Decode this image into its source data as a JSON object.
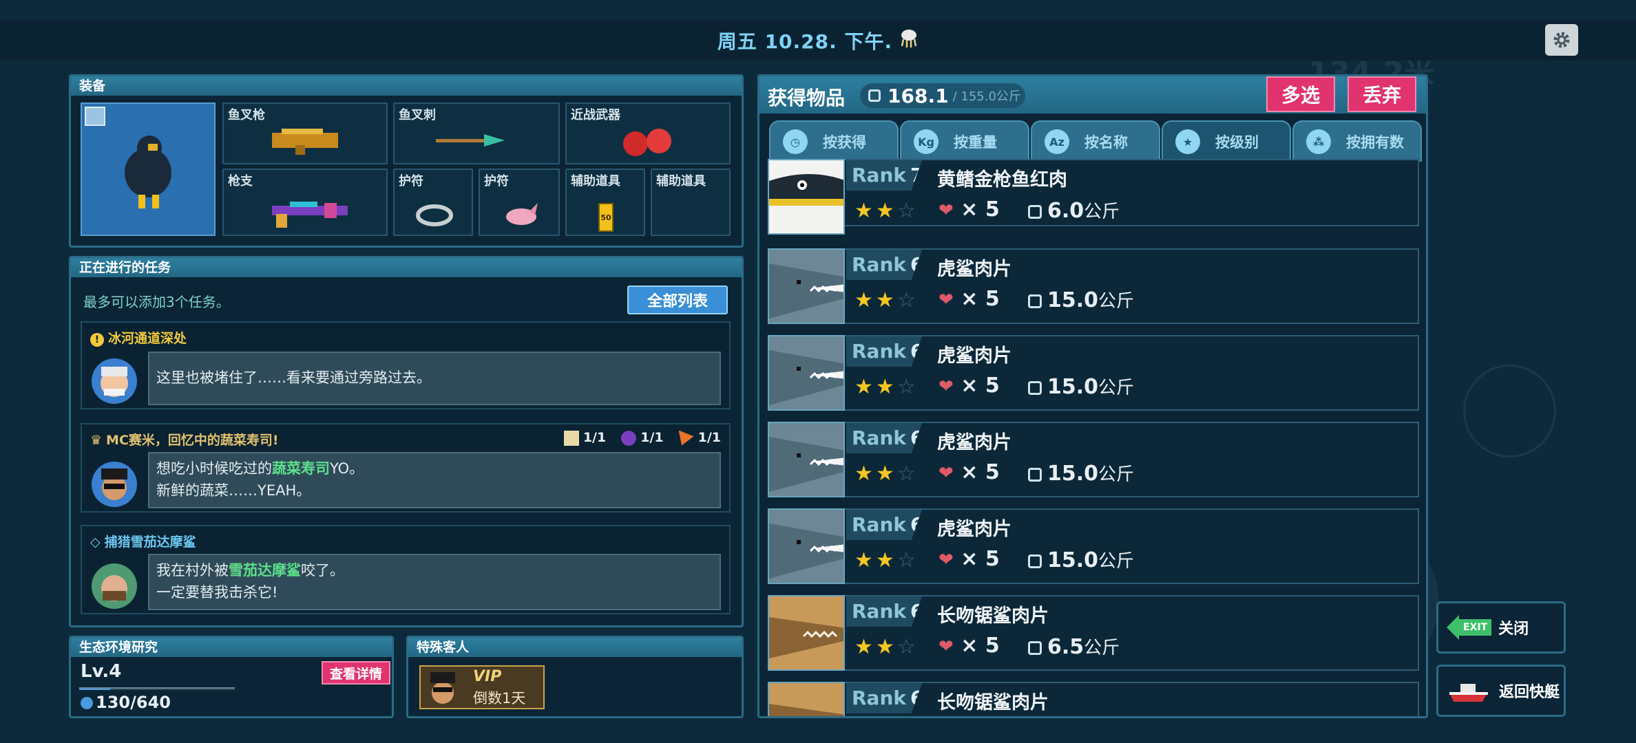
{
  "topbar": {
    "date": "周五 10.28. 下午.",
    "weather_icon": "jellyfish-rain-icon"
  },
  "equipment": {
    "title": "装备",
    "slots": [
      {
        "label": "鱼叉枪",
        "icon": "harpoon-gun-icon"
      },
      {
        "label": "鱼叉刺",
        "icon": "harpoon-spear-icon"
      },
      {
        "label": "近战武器",
        "icon": "boxing-glove-icon"
      },
      {
        "label": "枪支",
        "icon": "rifle-icon"
      },
      {
        "label": "护符",
        "icon": "ring-charm-icon"
      },
      {
        "label": "护符",
        "icon": "pink-dolphin-charm-icon"
      },
      {
        "label": "辅助道具",
        "icon": "oxygen-bottle-icon"
      },
      {
        "label": "辅助道具",
        "icon": ""
      }
    ],
    "bottle_label": "50"
  },
  "tasks": {
    "title": "正在进行的任务",
    "hint": "最多可以添加3个任务。",
    "all_list_label": "全部列表",
    "items": [
      {
        "title": "冰河通道深处",
        "title_icon": "exclamation-icon",
        "line1": "这里也被堵住了……看来要通过旁路过去。",
        "line2": ""
      },
      {
        "title": "MC赛米，回忆中的蔬菜寿司!",
        "title_icon": "crown-icon",
        "line1_pre": "想吃小时候吃过的",
        "line1_hl": "蔬菜寿司",
        "line1_post": "YO。",
        "line2": "新鲜的蔬菜……YEAH。",
        "reqs": [
          {
            "icon": "rice-icon",
            "count": "1/1"
          },
          {
            "icon": "eggplant-icon",
            "count": "1/1"
          },
          {
            "icon": "carrot-icon",
            "count": "1/1"
          }
        ]
      },
      {
        "title": "捕猎雪茄达摩鲨",
        "title_icon": "diamond-icon",
        "line1_pre": "我在村外被",
        "line1_hl": "雪茄达摩鲨",
        "line1_post": "咬了。",
        "line2": "一定要替我击杀它!"
      }
    ]
  },
  "eco": {
    "title": "生态环境研究",
    "level": "Lv.4",
    "detail_label": "查看详情",
    "progress": "130/640",
    "progress_value": 0.203
  },
  "guest": {
    "title": "特殊客人",
    "vip": "VIP",
    "countdown": "倒数1天"
  },
  "items": {
    "title": "获得物品",
    "weight": "168.1",
    "capacity": "/ 155.0公斤",
    "multi_label": "多选",
    "discard_label": "丢弃",
    "tabs": [
      {
        "label": "按获得",
        "icon": "clock-icon",
        "glyph": "◷"
      },
      {
        "label": "按重量",
        "icon": "kg-icon",
        "glyph": "Kg"
      },
      {
        "label": "按名称",
        "icon": "az-icon",
        "glyph": "Az"
      },
      {
        "label": "按级别",
        "icon": "star-icon",
        "glyph": "★"
      },
      {
        "label": "按拥有数",
        "icon": "dots-icon",
        "glyph": "⁂"
      }
    ],
    "rows": [
      {
        "rank_label": "Rank",
        "rank": "7",
        "name": "黄鳍金枪鱼红肉",
        "qty": "5",
        "weight": "6.0",
        "unit": "公斤",
        "thumb": "tuna"
      },
      {
        "rank_label": "Rank",
        "rank": "6",
        "name": "虎鲨肉片",
        "qty": "5",
        "weight": "15.0",
        "unit": "公斤",
        "thumb": "shark"
      },
      {
        "rank_label": "Rank",
        "rank": "6",
        "name": "虎鲨肉片",
        "qty": "5",
        "weight": "15.0",
        "unit": "公斤",
        "thumb": "shark"
      },
      {
        "rank_label": "Rank",
        "rank": "6",
        "name": "虎鲨肉片",
        "qty": "5",
        "weight": "15.0",
        "unit": "公斤",
        "thumb": "shark"
      },
      {
        "rank_label": "Rank",
        "rank": "6",
        "name": "虎鲨肉片",
        "qty": "5",
        "weight": "15.0",
        "unit": "公斤",
        "thumb": "shark"
      },
      {
        "rank_label": "Rank",
        "rank": "6",
        "name": "长吻锯鲨肉片",
        "qty": "5",
        "weight": "6.5",
        "unit": "公斤",
        "thumb": "sawshark"
      },
      {
        "rank_label": "Rank",
        "rank": "6",
        "name": "长吻锯鲨肉片",
        "qty": "",
        "weight": "",
        "unit": "",
        "thumb": "sawshark"
      }
    ],
    "stars": 2,
    "stars_max": 3
  },
  "side": {
    "close_tag": "EXIT",
    "close_label": "关闭",
    "boat_label": "返回快艇"
  },
  "colors": {
    "accent_pink": "#e0336f",
    "panel_border": "#2b6b86",
    "highlight_green": "#5de08a"
  }
}
